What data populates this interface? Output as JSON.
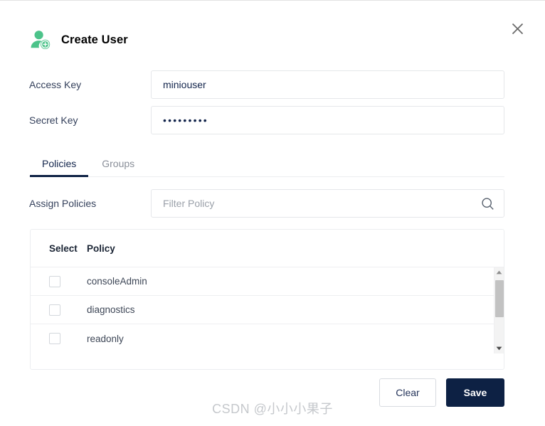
{
  "dialog": {
    "title": "Create User",
    "title_icon": "user-add-icon",
    "close_icon": "close-icon"
  },
  "form": {
    "access_key": {
      "label": "Access Key",
      "value": "miniouser",
      "placeholder": ""
    },
    "secret_key": {
      "label": "Secret Key",
      "value": "•••••••••",
      "masked_char_count": 9,
      "placeholder": ""
    }
  },
  "tabs": {
    "items": [
      {
        "label": "Policies",
        "active": true
      },
      {
        "label": "Groups",
        "active": false
      }
    ]
  },
  "assign": {
    "label": "Assign Policies",
    "filter_placeholder": "Filter Policy",
    "filter_value": "",
    "search_icon": "search-icon"
  },
  "table": {
    "columns": [
      "Select",
      "Policy"
    ],
    "rows": [
      {
        "selected": false,
        "policy": "consoleAdmin"
      },
      {
        "selected": false,
        "policy": "diagnostics"
      },
      {
        "selected": false,
        "policy": "readonly"
      }
    ],
    "scrollbar": {
      "up_icon": "caret-up-icon",
      "down_icon": "caret-down-icon"
    }
  },
  "footer": {
    "clear_label": "Clear",
    "save_label": "Save"
  },
  "watermark": {
    "text": "CSDN @小小小果子"
  },
  "colors": {
    "accent_dark": "#0d2144",
    "icon_green": "#4cc38a",
    "label_text": "#35415c",
    "value_text": "#12244b",
    "muted_text": "#8a8f99",
    "border": "#e5e7ea"
  }
}
